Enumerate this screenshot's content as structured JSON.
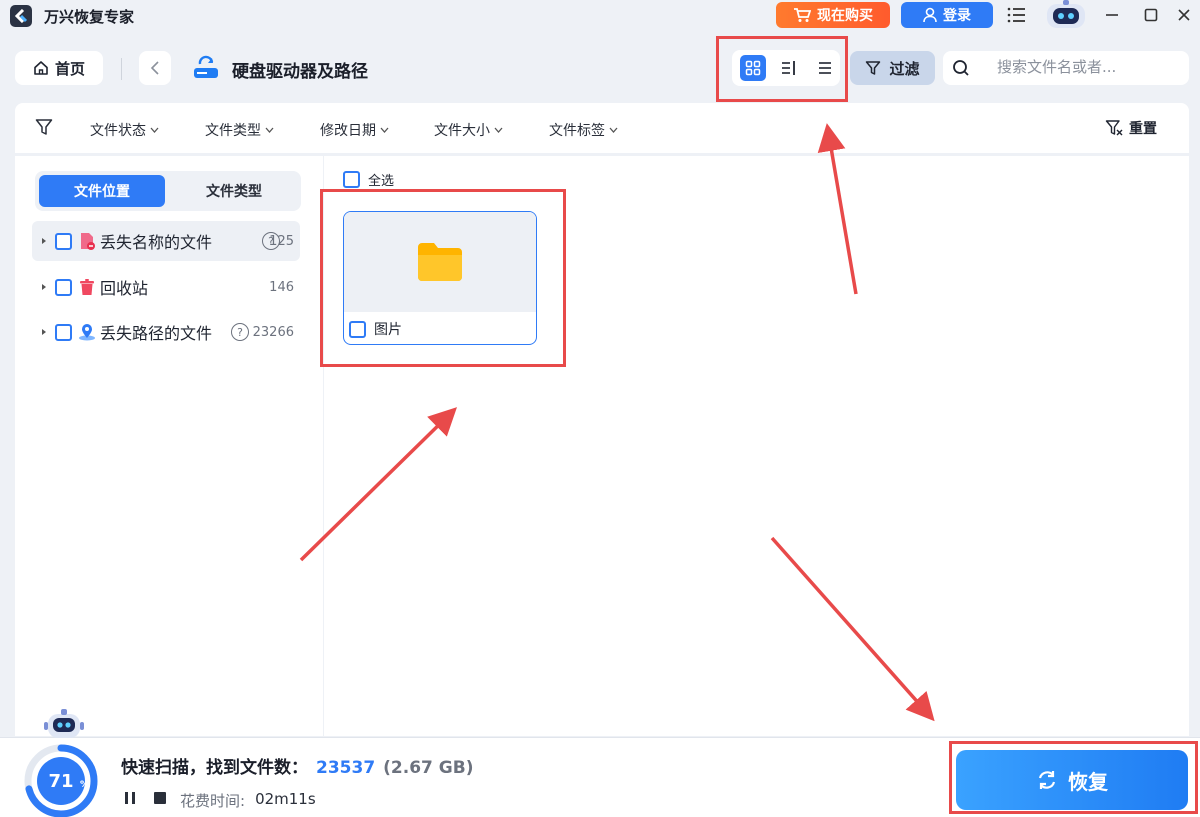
{
  "titlebar": {
    "app_title": "万兴恢复专家",
    "buy_label": "现在购买",
    "login_label": "登录",
    "icons": [
      "app-logo-icon",
      "cart-icon",
      "user-icon",
      "menu-icon",
      "bot-avatar-icon",
      "minimize-icon",
      "maximize-icon",
      "close-icon"
    ]
  },
  "toolbar": {
    "home_label": "首页",
    "path_title": "硬盘驱动器及路径",
    "filter_label": "过滤",
    "search_placeholder": "搜索文件名或者..."
  },
  "filter_bar": {
    "items": [
      "文件状态",
      "文件类型",
      "修改日期",
      "文件大小",
      "文件标签"
    ],
    "reset_label": "重置"
  },
  "left_panel": {
    "tabs": [
      "文件位置",
      "文件类型"
    ],
    "active_tab": 0,
    "tree": [
      {
        "label": "丢失名称的文件",
        "count": "125",
        "help": "?"
      },
      {
        "label": "回收站",
        "count": "146"
      },
      {
        "label": "丢失路径的文件",
        "count": "23266",
        "help": "?"
      }
    ]
  },
  "right_panel": {
    "select_all_label": "全选",
    "items": [
      {
        "label": "图片"
      }
    ]
  },
  "bottom_bar": {
    "progress_percent": "71",
    "percent_sign": "%",
    "progress_fraction": 0.71,
    "scan_label": "快速扫描，找到文件数：",
    "file_count": "23537",
    "file_size": "(2.67 GB)",
    "time_label": "花费时间:",
    "time_value": "02m11s",
    "recover_label": "恢复"
  },
  "colors": {
    "accent": "#2f7bf6",
    "buy": "#ff6a2d",
    "annotation": "#e84a4a",
    "folder": "#ffb400"
  }
}
